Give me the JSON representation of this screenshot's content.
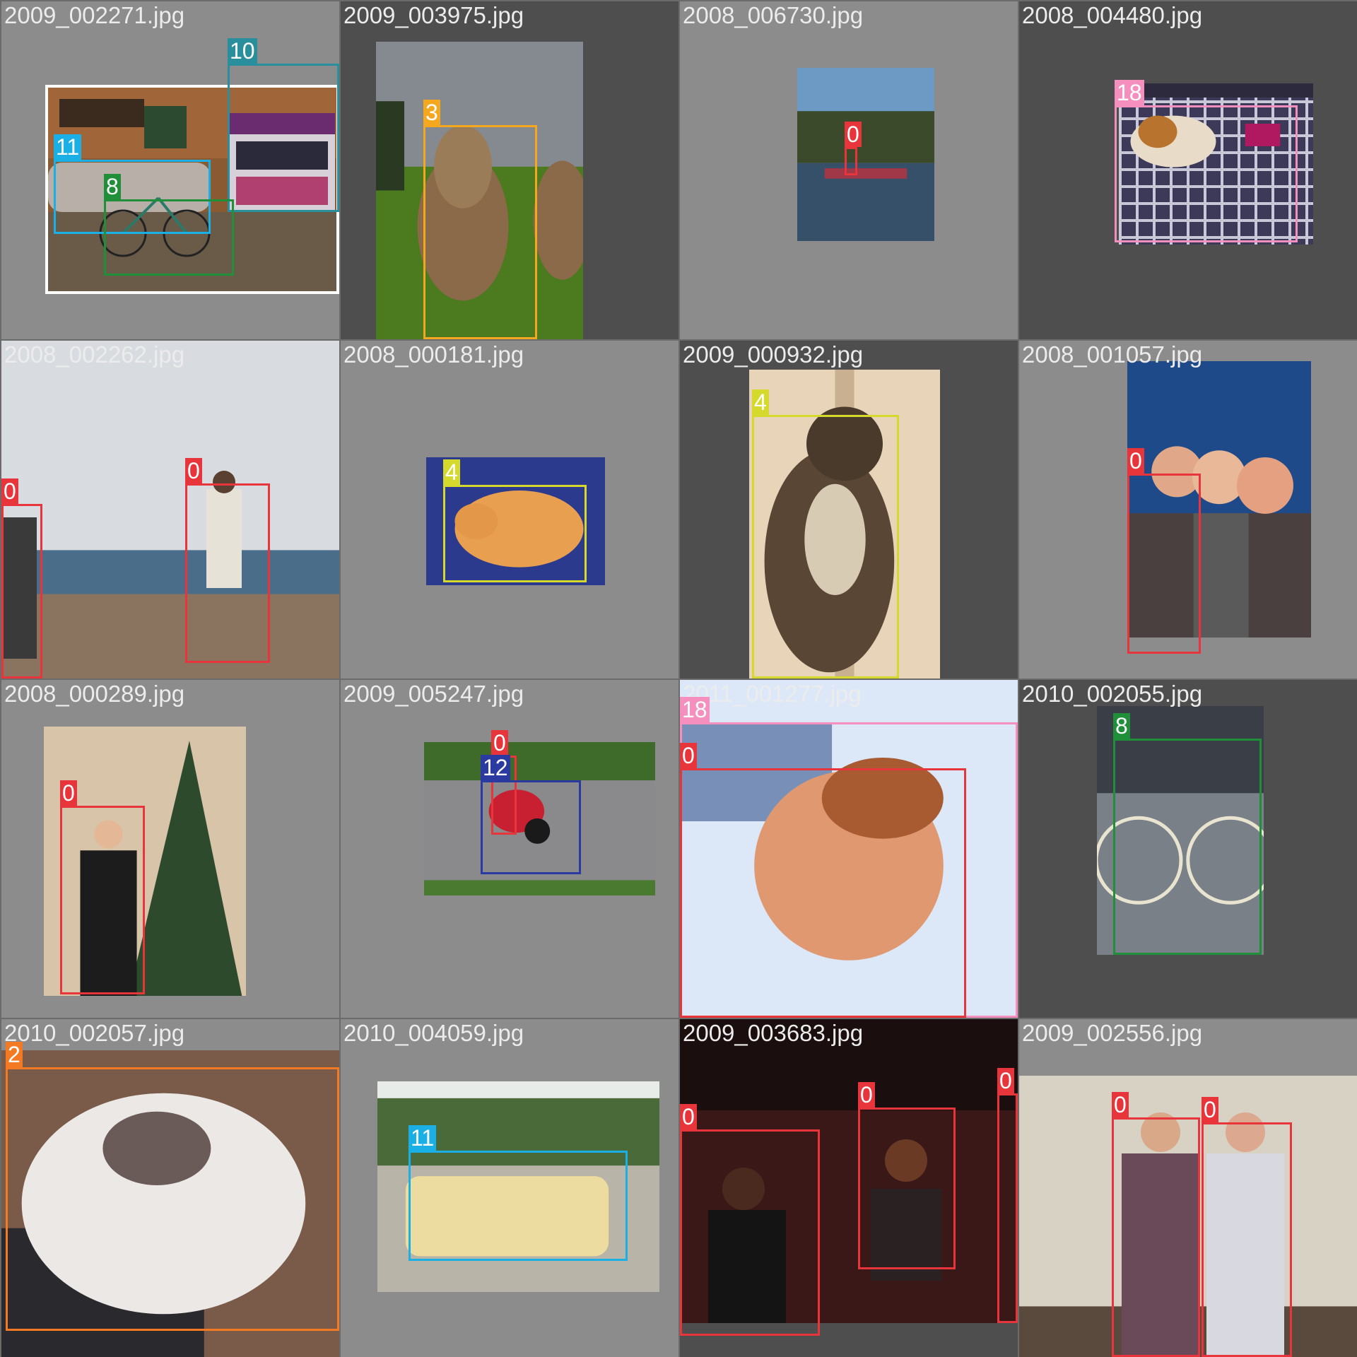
{
  "mosaic": {
    "colors": {
      "tile_gray": "#8c8c8c",
      "tile_dark": "#4e4e4e",
      "filename_text": "#ececec"
    },
    "tiles": [
      {
        "filename": "2009_002271.jpg",
        "scene": "street-bus-bicycle",
        "detections": [
          {
            "class_id": "10",
            "color": "#2a8f9c"
          },
          {
            "class_id": "11",
            "color": "#1ab0e6"
          },
          {
            "class_id": "8",
            "color": "#1f8f3a"
          }
        ]
      },
      {
        "filename": "2009_003975.jpg",
        "scene": "cow-field",
        "detections": [
          {
            "class_id": "3",
            "color": "#f5a81e"
          }
        ]
      },
      {
        "filename": "2008_006730.jpg",
        "scene": "swamp-boat",
        "detections": [
          {
            "class_id": "0",
            "color": "#e8343b"
          }
        ]
      },
      {
        "filename": "2008_004480.jpg",
        "scene": "dog-on-bed",
        "detections": [
          {
            "class_id": "18",
            "color": "#f590be"
          }
        ]
      },
      {
        "filename": "2008_002262.jpg",
        "scene": "squash-court",
        "detections": [
          {
            "class_id": "0",
            "color": "#e8343b"
          },
          {
            "class_id": "0",
            "color": "#e8343b"
          }
        ]
      },
      {
        "filename": "2008_000181.jpg",
        "scene": "sleeping-cat",
        "detections": [
          {
            "class_id": "4",
            "color": "#d4d92c"
          }
        ]
      },
      {
        "filename": "2009_000932.jpg",
        "scene": "falcon",
        "detections": [
          {
            "class_id": "4",
            "color": "#d4d92c"
          }
        ]
      },
      {
        "filename": "2008_001057.jpg",
        "scene": "group-photo",
        "detections": [
          {
            "class_id": "0",
            "color": "#e8343b"
          }
        ]
      },
      {
        "filename": "2008_000289.jpg",
        "scene": "christmas-tree-woman",
        "detections": [
          {
            "class_id": "0",
            "color": "#e8343b"
          }
        ]
      },
      {
        "filename": "2009_005247.jpg",
        "scene": "motorbike-race",
        "detections": [
          {
            "class_id": "0",
            "color": "#e8343b"
          },
          {
            "class_id": "12",
            "color": "#2b3aa0"
          }
        ]
      },
      {
        "filename": "2011_001277.jpg",
        "scene": "face-closeup",
        "detections": [
          {
            "class_id": "18",
            "color": "#f590be"
          },
          {
            "class_id": "0",
            "color": "#e8343b"
          }
        ]
      },
      {
        "filename": "2010_002055.jpg",
        "scene": "parked-bicycle",
        "detections": [
          {
            "class_id": "8",
            "color": "#1f8f3a"
          }
        ]
      },
      {
        "filename": "2010_002057.jpg",
        "scene": "cat-on-keyboard",
        "detections": [
          {
            "class_id": "2",
            "color": "#f37a22"
          }
        ]
      },
      {
        "filename": "2010_004059.jpg",
        "scene": "yellow-car",
        "detections": [
          {
            "class_id": "11",
            "color": "#1ab0e6"
          }
        ]
      },
      {
        "filename": "2009_003683.jpg",
        "scene": "singers-stage",
        "detections": [
          {
            "class_id": "0",
            "color": "#e8343b"
          },
          {
            "class_id": "0",
            "color": "#e8343b"
          },
          {
            "class_id": "0",
            "color": "#e8343b"
          }
        ]
      },
      {
        "filename": "2009_002556.jpg",
        "scene": "two-men-indoors",
        "detections": [
          {
            "class_id": "0",
            "color": "#e8343b"
          },
          {
            "class_id": "0",
            "color": "#e8343b"
          }
        ]
      }
    ]
  }
}
